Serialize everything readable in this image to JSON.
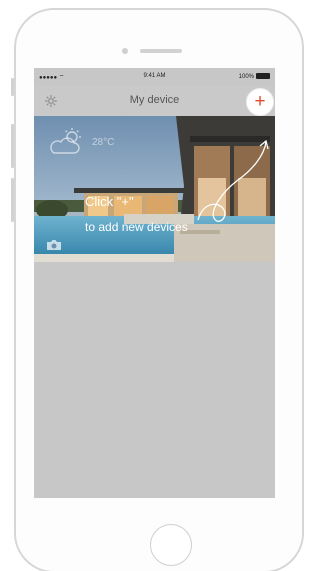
{
  "statusbar": {
    "signal": "●●●●● ",
    "wifi": "wifi-icon",
    "time": "9:41 AM",
    "battery": "100%"
  },
  "header": {
    "title": "My device",
    "settings_icon": "gear-icon",
    "add_label": "+"
  },
  "banner": {
    "temperature": "28°C",
    "weather_icon": "partly-cloudy-icon",
    "camera_icon": "camera-icon"
  },
  "hint": {
    "line1": "Click \"+\"",
    "line2": "to add new devices"
  },
  "colors": {
    "accent": "#e24c2f",
    "screen_bg": "#c7c7c7"
  }
}
